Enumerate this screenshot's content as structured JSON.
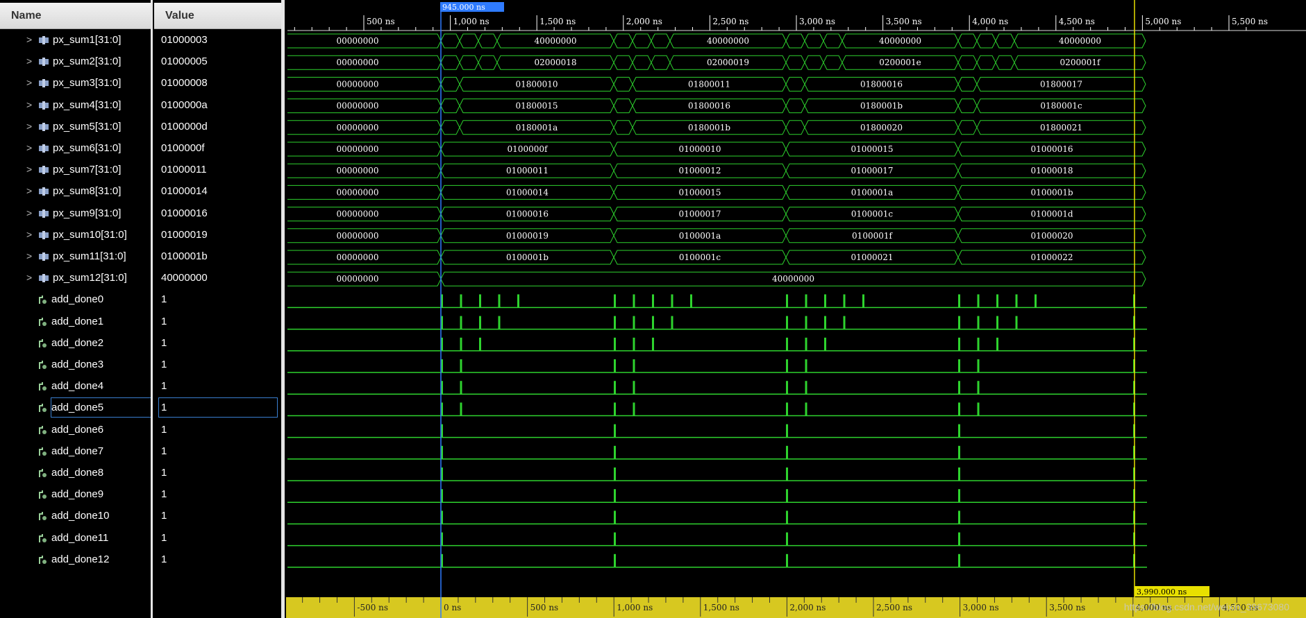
{
  "headers": {
    "name": "Name",
    "value": "Value"
  },
  "cursor": {
    "label": "945.000 ns",
    "time_ns": 945
  },
  "marker": {
    "label": "3,990.000 ns",
    "time_ns": 3990
  },
  "ruler_top": {
    "labels": [
      "500 ns",
      "1,000 ns",
      "1,500 ns",
      "2,000 ns",
      "2,500 ns",
      "3,000 ns",
      "3,500 ns",
      "4,000 ns",
      "4,500 ns",
      "5,000 ns",
      "5,500 ns"
    ]
  },
  "ruler_bottom": {
    "labels": [
      "-500 ns",
      "0 ns",
      "500 ns",
      "1,000 ns",
      "1,500 ns",
      "2,000 ns",
      "2,500 ns",
      "3,000 ns",
      "3,500 ns",
      "4,000 ns",
      "4,500 ns"
    ]
  },
  "colors": {
    "wave": "#2ed32e",
    "cursor": "#2f7bff",
    "marker": "#e8e000",
    "ruler_bg": "#d7c820"
  },
  "bus_signals": [
    {
      "name": "px_sum1[31:0]",
      "value": "01000003",
      "init": "00000000",
      "segments": [
        "40000000",
        "40000000",
        "40000000",
        "40000000"
      ]
    },
    {
      "name": "px_sum2[31:0]",
      "value": "01000005",
      "init": "00000000",
      "segments": [
        "02000018",
        "02000019",
        "0200001e",
        "0200001f"
      ]
    },
    {
      "name": "px_sum3[31:0]",
      "value": "01000008",
      "init": "00000000",
      "segments": [
        "01800010",
        "01800011",
        "01800016",
        "01800017"
      ]
    },
    {
      "name": "px_sum4[31:0]",
      "value": "0100000a",
      "init": "00000000",
      "segments": [
        "01800015",
        "01800016",
        "0180001b",
        "0180001c"
      ]
    },
    {
      "name": "px_sum5[31:0]",
      "value": "0100000d",
      "init": "00000000",
      "segments": [
        "0180001a",
        "0180001b",
        "01800020",
        "01800021"
      ]
    },
    {
      "name": "px_sum6[31:0]",
      "value": "0100000f",
      "init": "00000000",
      "segments": [
        "0100000f",
        "01000010",
        "01000015",
        "01000016"
      ]
    },
    {
      "name": "px_sum7[31:0]",
      "value": "01000011",
      "init": "00000000",
      "segments": [
        "01000011",
        "01000012",
        "01000017",
        "01000018"
      ]
    },
    {
      "name": "px_sum8[31:0]",
      "value": "01000014",
      "init": "00000000",
      "segments": [
        "01000014",
        "01000015",
        "0100001a",
        "0100001b"
      ]
    },
    {
      "name": "px_sum9[31:0]",
      "value": "01000016",
      "init": "00000000",
      "segments": [
        "01000016",
        "01000017",
        "0100001c",
        "0100001d"
      ]
    },
    {
      "name": "px_sum10[31:0]",
      "value": "01000019",
      "init": "00000000",
      "segments": [
        "01000019",
        "0100001a",
        "0100001f",
        "01000020"
      ]
    },
    {
      "name": "px_sum11[31:0]",
      "value": "0100001b",
      "init": "00000000",
      "segments": [
        "0100001b",
        "0100001c",
        "01000021",
        "01000022"
      ]
    },
    {
      "name": "px_sum12[31:0]",
      "value": "40000000",
      "init": "00000000",
      "segments": [
        "40000000"
      ]
    }
  ],
  "bit_signals": [
    {
      "name": "add_done0",
      "value": "1",
      "pulses": 5
    },
    {
      "name": "add_done1",
      "value": "1",
      "pulses": 4
    },
    {
      "name": "add_done2",
      "value": "1",
      "pulses": 3
    },
    {
      "name": "add_done3",
      "value": "1",
      "pulses": 2
    },
    {
      "name": "add_done4",
      "value": "1",
      "pulses": 2
    },
    {
      "name": "add_done5",
      "value": "1",
      "pulses": 2
    },
    {
      "name": "add_done6",
      "value": "1",
      "pulses": 1
    },
    {
      "name": "add_done7",
      "value": "1",
      "pulses": 1
    },
    {
      "name": "add_done8",
      "value": "1",
      "pulses": 1
    },
    {
      "name": "add_done9",
      "value": "1",
      "pulses": 1
    },
    {
      "name": "add_done10",
      "value": "1",
      "pulses": 1
    },
    {
      "name": "add_done11",
      "value": "1",
      "pulses": 1
    },
    {
      "name": "add_done12",
      "value": "1",
      "pulses": 1
    }
  ],
  "selected_signal": "add_done5",
  "watermark": "https://blog.csdn.net/weixin_39673080"
}
